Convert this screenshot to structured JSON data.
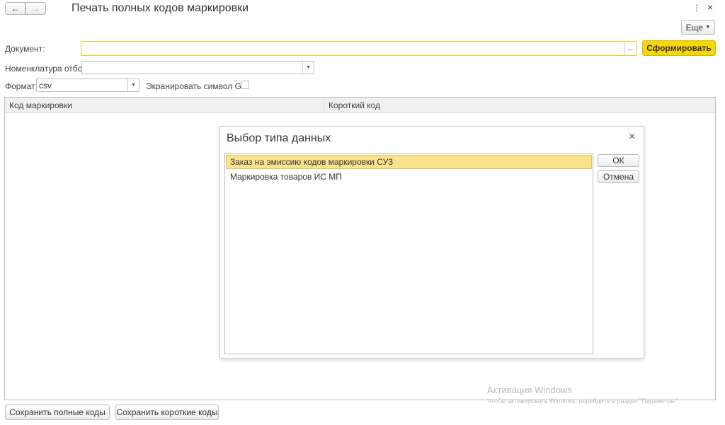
{
  "nav": {
    "back": "←",
    "forward": "→"
  },
  "title": "Печать полных кодов маркировки",
  "window": {
    "menu": "⋮",
    "close": "×"
  },
  "more_label": "Еще",
  "form": {
    "document_label": "Документ:",
    "document_value": "",
    "select_btn": "...",
    "generate_label": "Сформировать",
    "nomenclature_label": "Номенклатура отбор:",
    "nomenclature_value": "",
    "format_label": "Формат:",
    "format_value": "csv",
    "gs_label": "Экранировать символ GS:"
  },
  "table": {
    "columns": [
      "Код маркировки",
      "Короткий код"
    ]
  },
  "dialog": {
    "title": "Выбор типа данных",
    "items": [
      "Заказ на эмиссию кодов маркировки СУЗ",
      "Маркировка товаров ИС МП"
    ],
    "ok": "ОК",
    "cancel": "Отмена",
    "close": "×"
  },
  "footer": {
    "save_full": "Сохранить полные коды",
    "save_short": "Сохранить короткие коды"
  },
  "watermark": {
    "title": "Активация Windows",
    "text": "Чтобы активировать Windows, перейдите в раздел \"Параметры\"."
  },
  "colors": {
    "accent": "#f5d50c",
    "selected": "#fbe38d"
  }
}
